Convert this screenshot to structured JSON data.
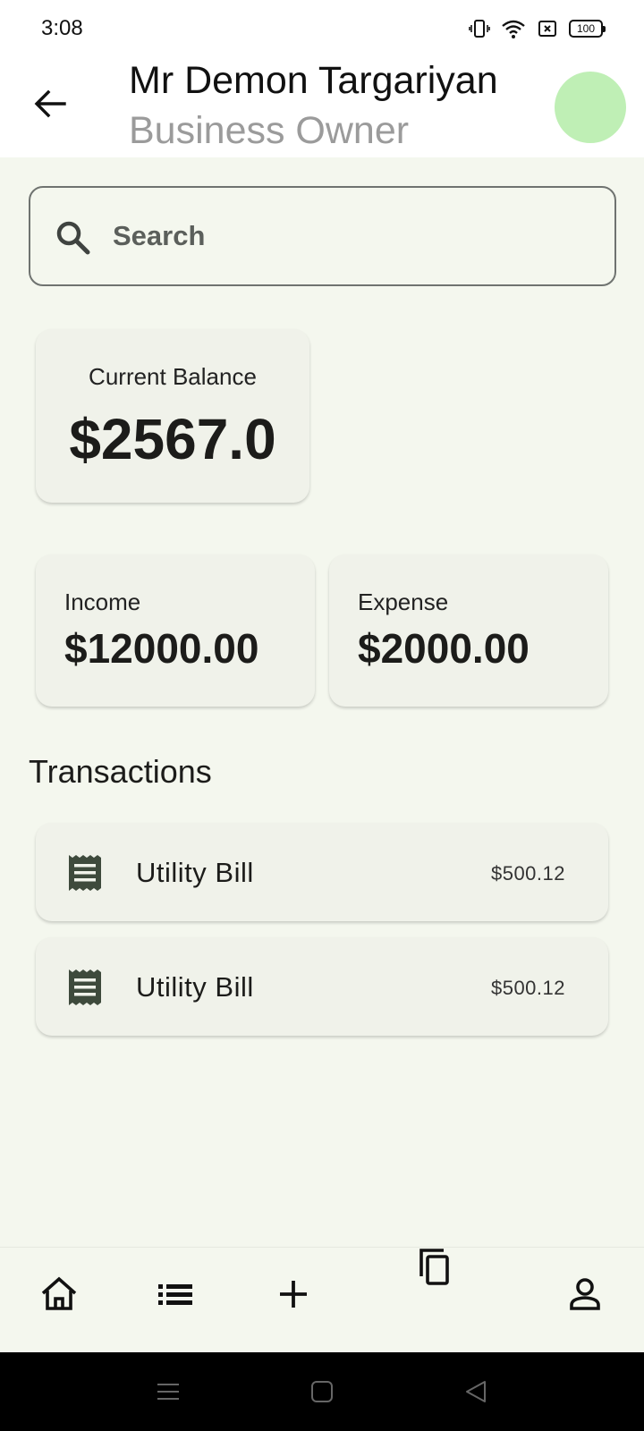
{
  "status_bar": {
    "time": "3:08",
    "battery": "100",
    "icons": [
      "vibrate-icon",
      "wifi-icon",
      "sim-off-icon",
      "battery-icon"
    ]
  },
  "header": {
    "name": "Mr Demon Targariyan",
    "role": "Business Owner",
    "avatar_color": "#bfefb5"
  },
  "search": {
    "placeholder": "Search",
    "value": ""
  },
  "balance": {
    "label": "Current Balance",
    "value": "$2567.0"
  },
  "income": {
    "label": "Income",
    "value": "$12000.00"
  },
  "expense": {
    "label": "Expense",
    "value": "$2000.00"
  },
  "transactions": {
    "title": "Transactions",
    "items": [
      {
        "title": "Utility Bill",
        "amount": "$500.12",
        "icon": "receipt-icon"
      },
      {
        "title": "Utility Bill",
        "amount": "$500.12",
        "icon": "receipt-icon"
      }
    ]
  },
  "bottom_nav": {
    "items": [
      "home-icon",
      "list-icon",
      "add-icon",
      "copy-icon",
      "profile-icon"
    ]
  },
  "colors": {
    "background": "#f4f7ee",
    "card": "#f0f2ea",
    "accent": "#bfefb5",
    "text": "#1c1c1a",
    "muted": "#9b9b9b"
  }
}
